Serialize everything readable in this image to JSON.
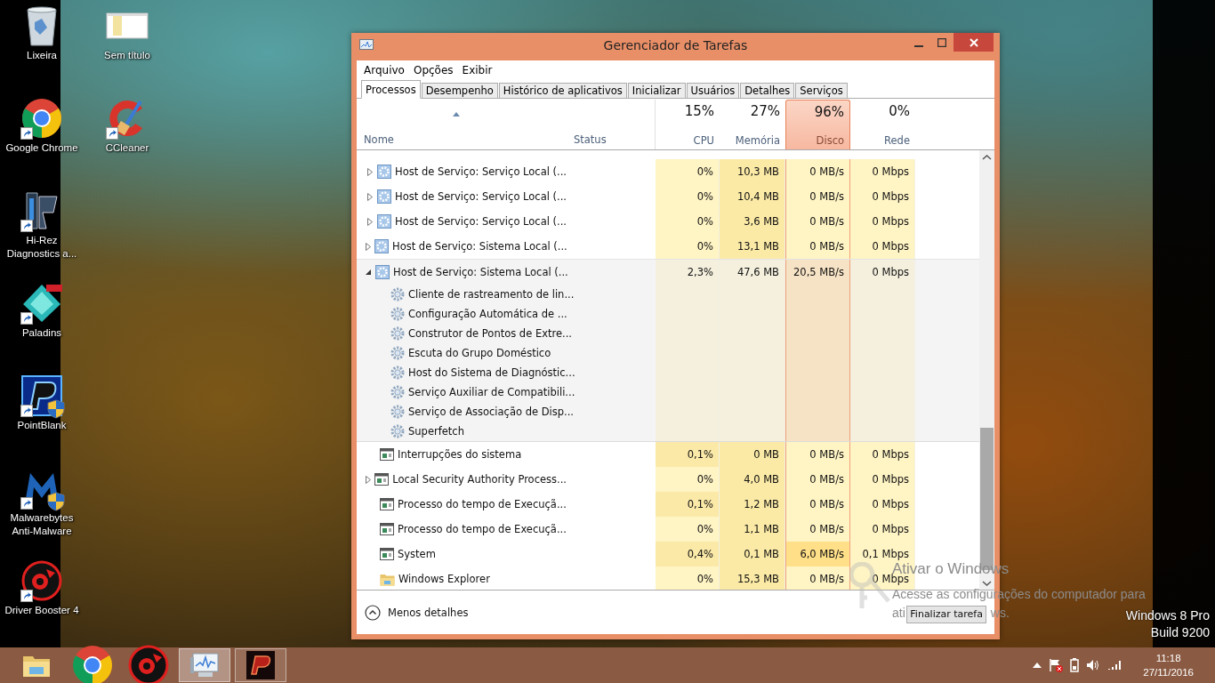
{
  "desktop": {
    "icons": [
      {
        "label": "Lixeira",
        "kind": "recycle-bin"
      },
      {
        "label": "Google Chrome",
        "kind": "chrome",
        "shortcut": true
      },
      {
        "label": "Hi-Rez Diagnostics a...",
        "kind": "hirez",
        "shortcut": true
      },
      {
        "label": "Paladins",
        "kind": "paladins",
        "shortcut": true
      },
      {
        "label": "PointBlank",
        "kind": "pointblank",
        "shortcut": true,
        "shield": true
      },
      {
        "label": "Malwarebytes Anti-Malware",
        "kind": "malwarebytes",
        "shortcut": true,
        "shield": true
      },
      {
        "label": "Driver Booster 4",
        "kind": "booster",
        "shortcut": true
      },
      {
        "label": "Sem título",
        "kind": "document"
      },
      {
        "label": "CCleaner",
        "kind": "ccleaner",
        "shortcut": true
      }
    ]
  },
  "window": {
    "title": "Gerenciador de Tarefas",
    "menu": [
      "Arquivo",
      "Opções",
      "Exibir"
    ],
    "tabs": [
      {
        "label": "Processos",
        "selected": true
      },
      {
        "label": "Desempenho",
        "selected": false
      },
      {
        "label": "Histórico de aplicativos",
        "selected": false
      },
      {
        "label": "Inicializar",
        "selected": false
      },
      {
        "label": "Usuários",
        "selected": false
      },
      {
        "label": "Detalhes",
        "selected": false
      },
      {
        "label": "Serviços",
        "selected": false
      }
    ],
    "name_column": {
      "label": "Nome",
      "sorted": true
    },
    "status_column": {
      "label": "Status"
    },
    "metric_columns": [
      {
        "percent": "15%",
        "label": "CPU",
        "selected": false
      },
      {
        "percent": "27%",
        "label": "Memória",
        "selected": false
      },
      {
        "percent": "96%",
        "label": "Disco",
        "selected": true
      },
      {
        "percent": "0%",
        "label": "Rede",
        "selected": false
      }
    ],
    "rows": [
      {
        "name": "Host de Serviço: Serviço Local (...",
        "kind": "service",
        "expandable": true,
        "expanded": false,
        "values": [
          "0%",
          "10,3 MB",
          "0 MB/s",
          "0 Mbps"
        ]
      },
      {
        "name": "Host de Serviço: Serviço Local (...",
        "kind": "service",
        "expandable": true,
        "expanded": false,
        "values": [
          "0%",
          "10,4 MB",
          "0 MB/s",
          "0 Mbps"
        ]
      },
      {
        "name": "Host de Serviço: Serviço Local (...",
        "kind": "service",
        "expandable": true,
        "expanded": false,
        "values": [
          "0%",
          "3,6 MB",
          "0 MB/s",
          "0 Mbps"
        ]
      },
      {
        "name": "Host de Serviço: Sistema Local (...",
        "kind": "service",
        "expandable": true,
        "expanded": false,
        "values": [
          "0%",
          "13,1 MB",
          "0 MB/s",
          "0 Mbps"
        ]
      },
      {
        "name": "Host de Serviço: Sistema Local (...",
        "kind": "service",
        "expandable": true,
        "expanded": true,
        "values": [
          "2,3%",
          "47,6 MB",
          "20,5 MB/s",
          "0 Mbps"
        ],
        "children": [
          {
            "name": "Cliente de rastreamento de lin..."
          },
          {
            "name": "Configuração Automática de ..."
          },
          {
            "name": "Construtor de Pontos de Extre..."
          },
          {
            "name": "Escuta do Grupo Doméstico"
          },
          {
            "name": "Host do Sistema de Diagnóstic..."
          },
          {
            "name": "Serviço Auxiliar de Compatibili..."
          },
          {
            "name": "Serviço de Associação de Disp..."
          },
          {
            "name": "Superfetch"
          }
        ]
      },
      {
        "name": "Interrupções do sistema",
        "kind": "process",
        "expandable": false,
        "values": [
          "0,1%",
          "0 MB",
          "0 MB/s",
          "0 Mbps"
        ]
      },
      {
        "name": "Local Security Authority Process...",
        "kind": "process",
        "expandable": true,
        "expanded": false,
        "values": [
          "0%",
          "4,0 MB",
          "0 MB/s",
          "0 Mbps"
        ]
      },
      {
        "name": "Processo do tempo de Execuçã...",
        "kind": "process",
        "expandable": false,
        "values": [
          "0,1%",
          "1,2 MB",
          "0 MB/s",
          "0 Mbps"
        ]
      },
      {
        "name": "Processo do tempo de Execuçã...",
        "kind": "process",
        "expandable": false,
        "values": [
          "0%",
          "1,1 MB",
          "0 MB/s",
          "0 Mbps"
        ]
      },
      {
        "name": "System",
        "kind": "process",
        "expandable": false,
        "values": [
          "0,4%",
          "0,1 MB",
          "6,0 MB/s",
          "0,1 Mbps"
        ]
      },
      {
        "name": "Windows Explorer",
        "kind": "folder",
        "expandable": false,
        "values": [
          "0%",
          "15,3 MB",
          "0 MB/s",
          "0 Mbps"
        ]
      }
    ],
    "footer": {
      "toggle": "Menos detalhes",
      "button": "Finalizar tarefa"
    }
  },
  "activation": {
    "title": "Ativar o Windows",
    "line": "Acesse as configurações do computador para",
    "last_line_parts": [
      "ati",
      "ws."
    ]
  },
  "edition": [
    "Windows 8 Pro",
    "Build 9200"
  ],
  "taskbar": {
    "apps": [
      {
        "kind": "folder",
        "running": false,
        "active": false
      },
      {
        "kind": "chrome",
        "running": false,
        "active": false
      },
      {
        "kind": "booster",
        "running": false,
        "active": false
      },
      {
        "kind": "taskmanager",
        "running": true,
        "active": true
      },
      {
        "kind": "pointblank",
        "running": true,
        "active": false
      }
    ],
    "clock": {
      "time": "11:18",
      "date": "27/11/2016"
    }
  }
}
